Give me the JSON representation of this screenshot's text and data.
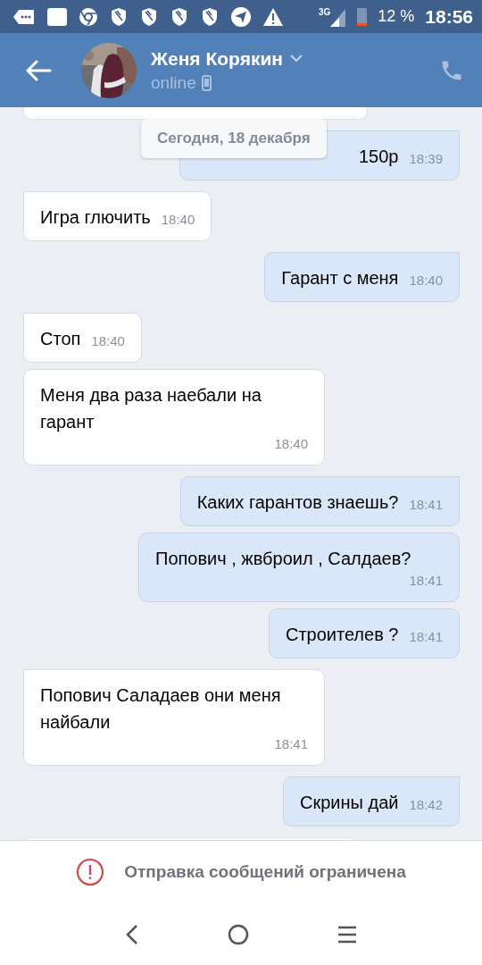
{
  "status_bar": {
    "network": "3G",
    "battery_percent": "12 %",
    "time": "18:56"
  },
  "header": {
    "name": "Женя Корякин",
    "status": "online"
  },
  "date_pill": "Сегодня, 18 декабря",
  "messages": [
    {
      "kind": "outgoing",
      "text": "150р",
      "time": "18:39",
      "tail": true,
      "partly_covered": true
    },
    {
      "kind": "incoming",
      "text": "Игра глючить",
      "time": "18:40",
      "tail": true
    },
    {
      "kind": "outgoing",
      "text": "Гарант с меня",
      "time": "18:40",
      "tail": true
    },
    {
      "kind": "incoming",
      "text": "Стоп",
      "time": "18:40",
      "tail": true
    },
    {
      "kind": "incoming",
      "text": "Меня два раза наебали на гарант",
      "time": "18:40",
      "tail": false
    },
    {
      "kind": "outgoing",
      "text": "Каких гарантов знаешь?",
      "time": "18:41",
      "tail": true
    },
    {
      "kind": "outgoing",
      "text": "Попович , жвброил , Салдаев?",
      "time": "18:41",
      "tail": false
    },
    {
      "kind": "outgoing",
      "text": "Строителев ?",
      "time": "18:41",
      "tail": false
    },
    {
      "kind": "incoming",
      "text": "Попович Саладаев они меня найбали",
      "time": "18:41",
      "tail": true
    },
    {
      "kind": "outgoing",
      "text": "Скрины дай",
      "time": "18:42",
      "tail": true
    }
  ],
  "restriction_notice": "Отправка сообщений ограничена"
}
